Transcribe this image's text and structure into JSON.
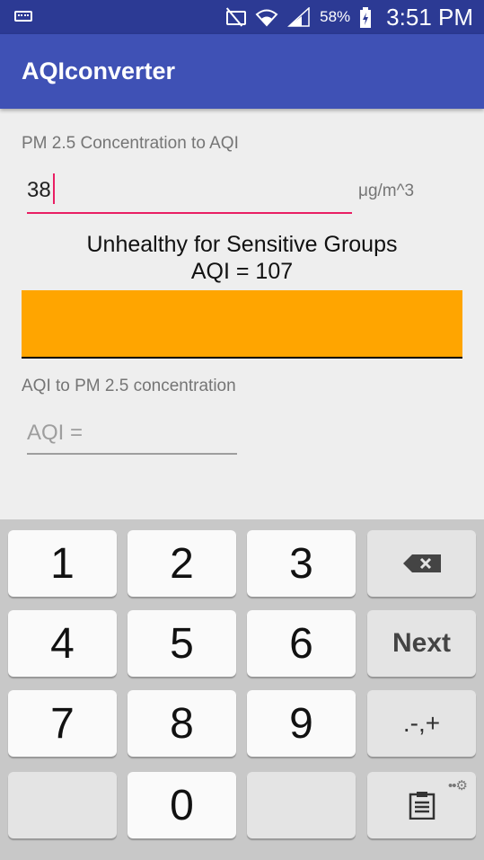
{
  "status_bar": {
    "battery": "58%",
    "time": "3:51 PM"
  },
  "app": {
    "title": "AQIconverter"
  },
  "pm_to_aqi": {
    "label": "PM 2.5 Concentration to AQI",
    "input_value": "38",
    "unit": "μg/m^3",
    "category": "Unhealthy for Sensitive Groups",
    "result": "AQI = 107",
    "color": "#FFA500"
  },
  "aqi_to_pm": {
    "label": "AQI to PM 2.5 concentration",
    "placeholder": "AQI ="
  },
  "keyboard": {
    "keys": [
      "1",
      "2",
      "3",
      "4",
      "5",
      "6",
      "7",
      "8",
      "9",
      "0"
    ],
    "next_label": "Next",
    "symbols_label": ".-,+",
    "backspace_icon": "backspace-icon",
    "clipboard_icon": "clipboard-icon",
    "settings_icon": "gear-icon"
  }
}
